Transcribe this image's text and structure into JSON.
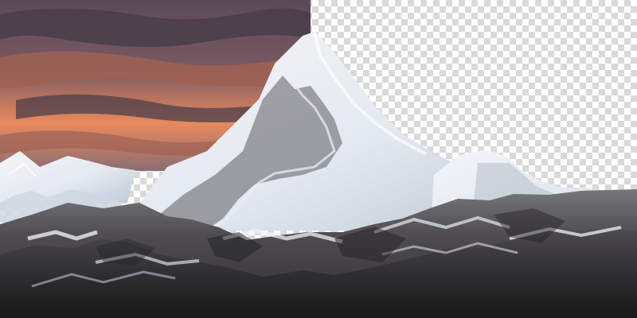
{
  "image": {
    "subject": "snow-covered-mountain-peak-at-sunset",
    "background": "transparent-checkerboard",
    "palette": {
      "checker_light": "#ffffff",
      "checker_dark": "#d9d9d9",
      "sky_top": "#5a4b57",
      "sky_mid": "#7a5862",
      "sky_glow": "#e98a5d",
      "cloud_dark": "#4b3f4a",
      "cloud_warm": "#9f6254",
      "snow_light": "#f3f5f8",
      "snow_shadow": "#b9c5d3",
      "rock_dark": "#2f2d2f",
      "rock_mid": "#4f4d50",
      "rock_light": "#77777c"
    }
  }
}
